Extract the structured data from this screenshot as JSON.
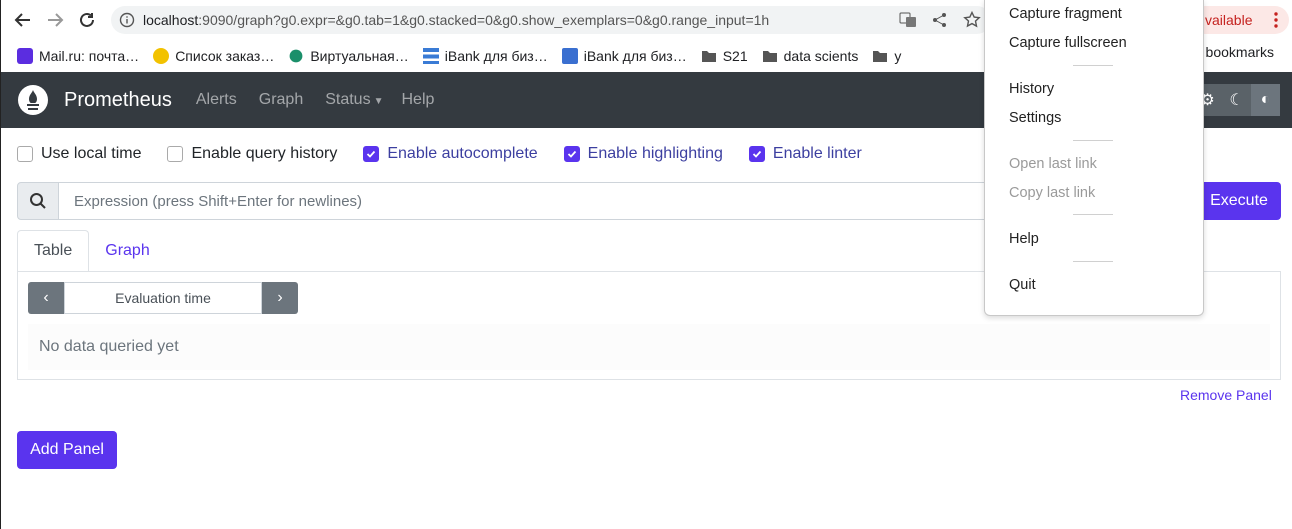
{
  "browser": {
    "url_host": "localhost",
    "url_rest": ":9090/graph?g0.expr=&g0.tab=1&g0.stacked=0&g0.show_exemplars=0&g0.range_input=1h",
    "update_label": "vailable",
    "bookmarks": [
      "Mail.ru: почта…",
      "Список заказ…",
      "Виртуальная…",
      "iBank для биз…",
      "iBank для биз…",
      "S21",
      "data scients",
      "у"
    ],
    "bookmarks_right": "r bookmarks"
  },
  "navbar": {
    "brand": "Prometheus",
    "links": [
      "Alerts",
      "Graph",
      "Status",
      "Help"
    ]
  },
  "options": {
    "use_local_time": "Use local time",
    "query_history": "Enable query history",
    "autocomplete": "Enable autocomplete",
    "highlighting": "Enable highlighting",
    "linter": "Enable linter"
  },
  "expression": {
    "placeholder": "Expression (press Shift+Enter for newlines)",
    "execute": "Execute"
  },
  "tabs": [
    "Table",
    "Graph"
  ],
  "panel": {
    "eval_time": "Evaluation time",
    "no_data": "No data queried yet",
    "remove": "Remove Panel"
  },
  "add_panel": "Add Panel",
  "context_menu": {
    "items": [
      "Capture fragment",
      "Capture fullscreen",
      "History",
      "Settings",
      "Open last link",
      "Copy last link",
      "Help",
      "Quit"
    ]
  },
  "colors": {
    "primary": "#5a34ee",
    "navbar": "#343a40"
  }
}
